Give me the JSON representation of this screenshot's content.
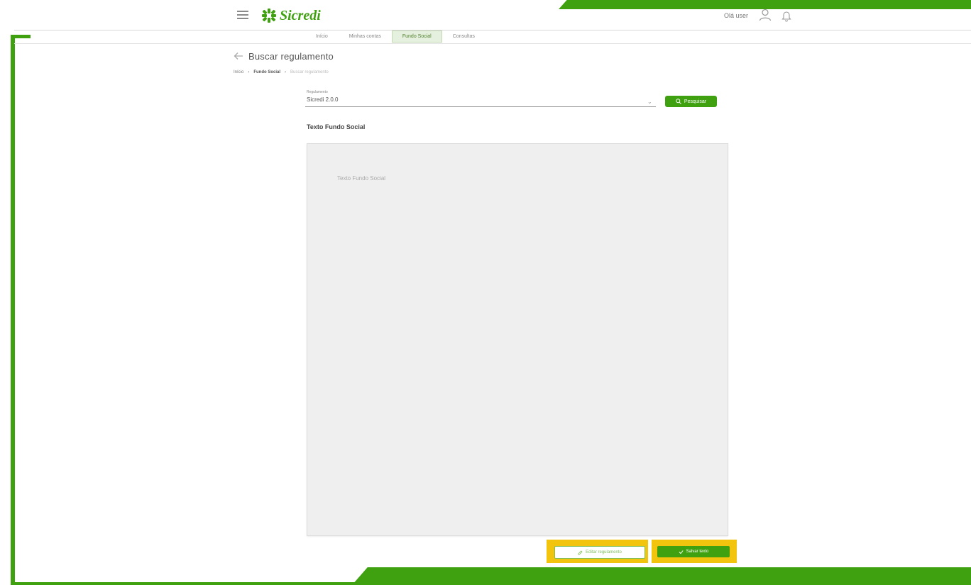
{
  "brand": {
    "name": "Sicredi",
    "color": "#3fa110"
  },
  "header": {
    "user_name": "Olá user"
  },
  "nav": {
    "tabs": [
      {
        "label": "Início",
        "active": false
      },
      {
        "label": "Minhas contas",
        "active": false
      },
      {
        "label": "Fundo Social",
        "active": true
      },
      {
        "label": "Consultas",
        "active": false
      }
    ]
  },
  "page": {
    "title": "Buscar regulamento",
    "breadcrumb": [
      "Início",
      "Fundo Social",
      "Buscar regulamento"
    ]
  },
  "form": {
    "select_label": "Regulamento",
    "select_value": "Sicredi 2.0.0",
    "search_button": "Pesquisar"
  },
  "section": {
    "title": "Texto Fundo Social",
    "content": "Texto Fundo Social"
  },
  "actions": {
    "secondary_label": "Editar regulamento",
    "primary_label": "Salvar texto"
  },
  "icons": {
    "menu": "hamburger-icon",
    "user": "user-icon",
    "notifications": "bell-icon",
    "back": "back-arrow-icon",
    "search": "search-icon"
  },
  "highlight_color": "#f2c40d"
}
